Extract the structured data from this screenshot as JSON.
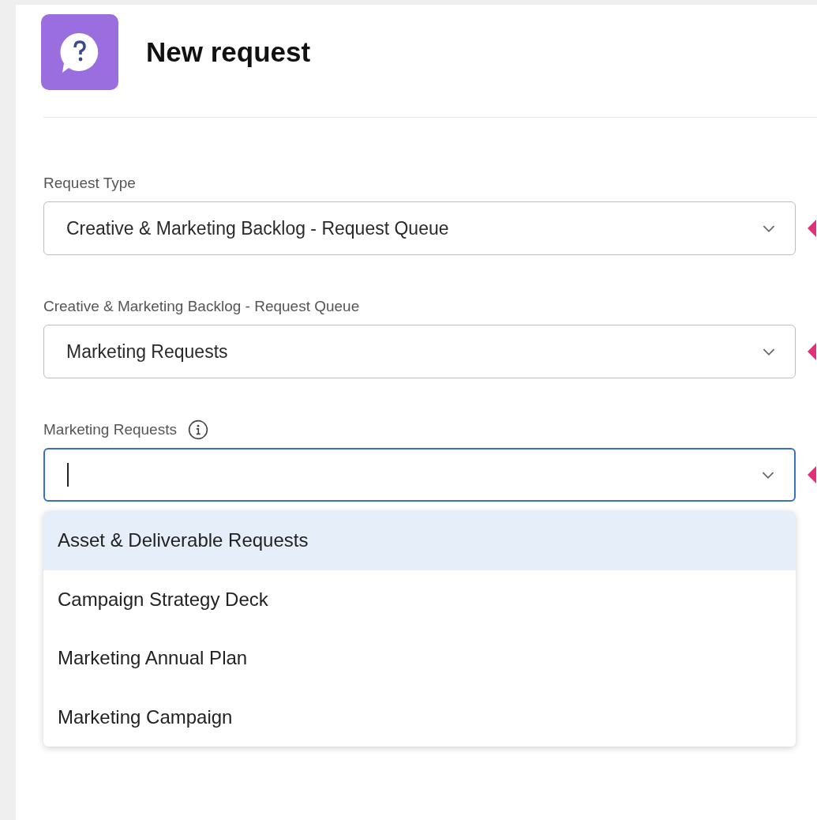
{
  "header": {
    "title": "New request"
  },
  "fields": [
    {
      "label": "Request Type",
      "info": false,
      "value": "Creative & Marketing Backlog - Request Queue",
      "focused": false,
      "marker": true
    },
    {
      "label": "Creative & Marketing Backlog - Request Queue",
      "info": false,
      "value": "Marketing Requests",
      "focused": false,
      "marker": true
    },
    {
      "label": "Marketing Requests",
      "info": true,
      "focused": true,
      "marker": true
    }
  ],
  "dropdown": {
    "options": [
      {
        "label": "Asset & Deliverable Requests",
        "selected": true
      },
      {
        "label": "Campaign Strategy Deck",
        "selected": false
      },
      {
        "label": "Marketing Annual Plan",
        "selected": false
      },
      {
        "label": "Marketing Campaign",
        "selected": false
      }
    ]
  }
}
